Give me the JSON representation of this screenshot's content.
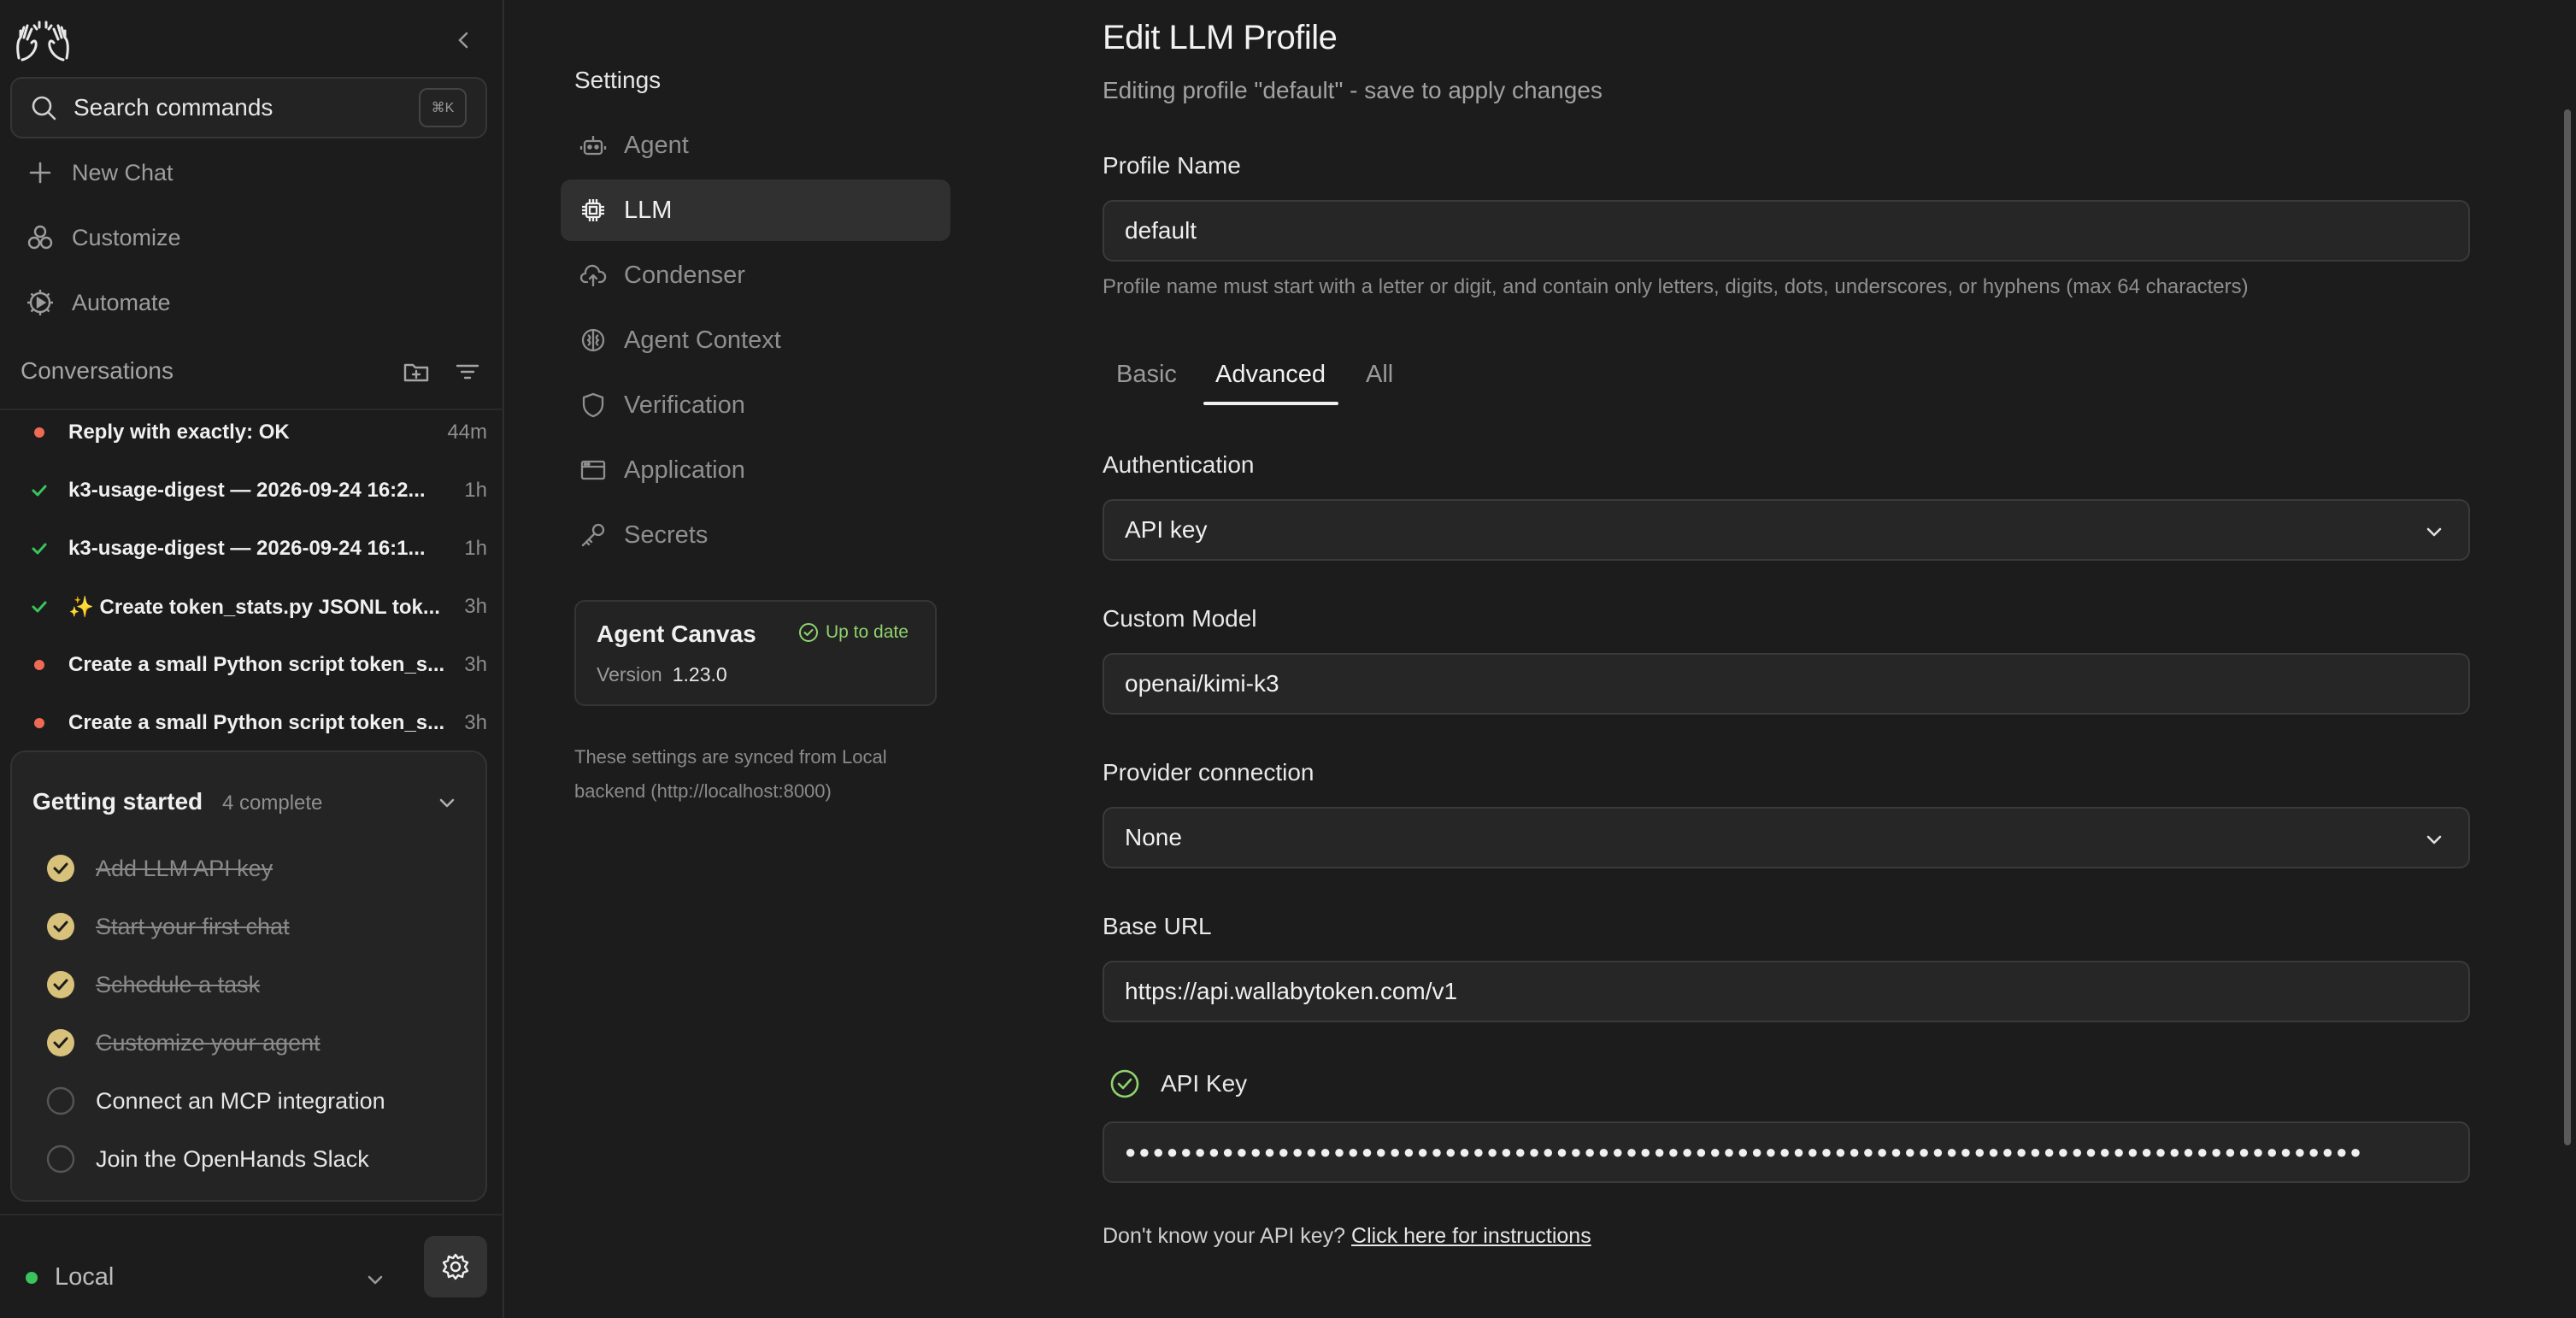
{
  "sidebar": {
    "search": {
      "label": "Search commands",
      "shortcut": "⌘K"
    },
    "nav": [
      {
        "label": "New Chat",
        "icon": "plus-icon"
      },
      {
        "label": "Customize",
        "icon": "shapes-icon"
      },
      {
        "label": "Automate",
        "icon": "automate-gear-icon"
      }
    ],
    "conversations_title": "Conversations",
    "conversations": [
      {
        "title": "Reply with exactly: OK",
        "time": "44m",
        "status": "error"
      },
      {
        "title": "k3-usage-digest — 2026-09-24 16:2...",
        "time": "1h",
        "status": "done"
      },
      {
        "title": "k3-usage-digest — 2026-09-24 16:1...",
        "time": "1h",
        "status": "done"
      },
      {
        "title": "✨ Create token_stats.py JSONL tok...",
        "time": "3h",
        "status": "done"
      },
      {
        "title": "Create a small Python script token_s...",
        "time": "3h",
        "status": "error"
      },
      {
        "title": "Create a small Python script token_s...",
        "time": "3h",
        "status": "error"
      }
    ],
    "getting_started": {
      "title": "Getting started",
      "count": "4 complete",
      "tasks": [
        {
          "label": "Add LLM API key",
          "done": true
        },
        {
          "label": "Start your first chat",
          "done": true
        },
        {
          "label": "Schedule a task",
          "done": true
        },
        {
          "label": "Customize your agent",
          "done": true
        },
        {
          "label": "Connect an MCP integration",
          "done": false
        },
        {
          "label": "Join the OpenHands Slack",
          "done": false
        }
      ]
    },
    "backend": {
      "label": "Local",
      "status_color": "#3ac45d"
    }
  },
  "settings_nav": {
    "title": "Settings",
    "items": [
      {
        "label": "Agent",
        "icon": "robot-icon"
      },
      {
        "label": "LLM",
        "icon": "chip-icon",
        "active": true
      },
      {
        "label": "Condenser",
        "icon": "cloud-icon"
      },
      {
        "label": "Agent Context",
        "icon": "brain-icon"
      },
      {
        "label": "Verification",
        "icon": "shield-icon"
      },
      {
        "label": "Application",
        "icon": "window-icon"
      },
      {
        "label": "Secrets",
        "icon": "key-icon"
      }
    ],
    "canvas": {
      "name": "Agent Canvas",
      "status": "Up to date",
      "version_label": "Version",
      "version": "1.23.0"
    },
    "sync_note": "These settings are synced from Local backend (http://localhost:8000)"
  },
  "form": {
    "title": "Edit LLM Profile",
    "subtitle": "Editing profile \"default\" - save to apply changes",
    "profile_name_label": "Profile Name",
    "profile_name_value": "default",
    "profile_name_hint": "Profile name must start with a letter or digit, and contain only letters, digits, dots, underscores, or hyphens (max 64 characters)",
    "tabs": [
      {
        "label": "Basic"
      },
      {
        "label": "Advanced",
        "active": true
      },
      {
        "label": "All"
      }
    ],
    "auth_label": "Authentication",
    "auth_value": "API key",
    "model_label": "Custom Model",
    "model_value": "openai/kimi-k3",
    "provider_label": "Provider connection",
    "provider_value": "None",
    "base_url_label": "Base URL",
    "base_url_value": "https://api.wallabytoken.com/v1",
    "api_key_label": "API Key",
    "api_key_masked": "●●●●●●●●●●●●●●●●●●●●●●●●●●●●●●●●●●●●●●●●●●●●●●●●●●●●●●●●●●●●●●●●●●●●●●●●●●●●●●●●●●●●●●●●●",
    "help_prefix": "Don't know your API key?",
    "help_link": "Click here for instructions"
  },
  "colors": {
    "accent_check": "#d8c17a",
    "ok_green": "#8fd36e",
    "error_dot": "#ef6a55",
    "done_check": "#3ac45d"
  }
}
